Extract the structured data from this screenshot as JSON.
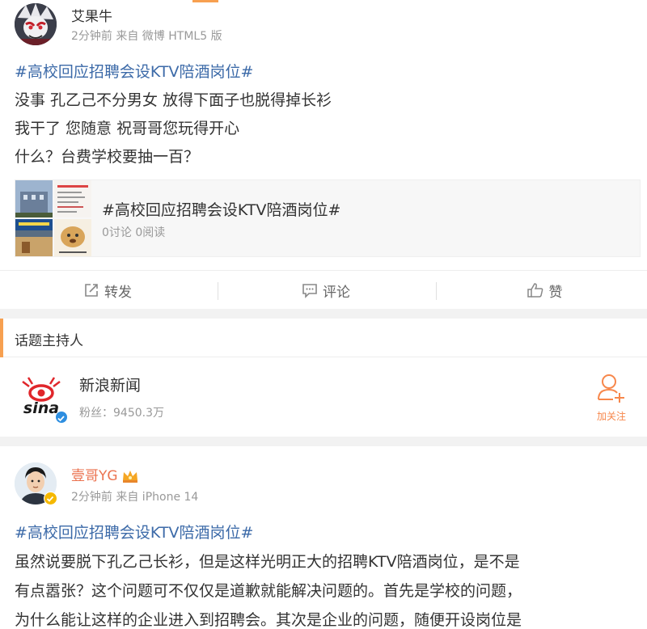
{
  "post1": {
    "author": "艾果牛",
    "meta": "2分钟前 来自 微博 HTML5 版",
    "hashtag": "#高校回应招聘会设KTV陪酒岗位#",
    "lines": [
      "没事 孔乙己不分男女 放得下面子也脱得掉长衫",
      "我干了 您随意 祝哥哥您玩得开心",
      "什么？台费学校要抽一百？"
    ],
    "topic_card": {
      "title": "#高校回应招聘会设KTV陪酒岗位#",
      "stats": "0讨论 0阅读"
    },
    "actions": {
      "repost": "转发",
      "comment": "评论",
      "like": "赞"
    }
  },
  "host_section": {
    "header": "话题主持人",
    "name": "新浪新闻",
    "fans": "粉丝：9450.3万",
    "follow_label": "加关注",
    "logo_text": "sina"
  },
  "post2": {
    "author": "壹哥YG",
    "meta": "2分钟前 来自 iPhone 14",
    "hashtag": "#高校回应招聘会设KTV陪酒岗位#",
    "lines": [
      "虽然说要脱下孔乙己长衫，但是这样光明正大的招聘KTV陪酒岗位，是不是",
      "有点嚣张？这个问题可不仅仅是道歉就能解决问题的。首先是学校的问题，",
      "为什么能让这样的企业进入到招聘会。其次是企业的问题，随便开设岗位是"
    ]
  },
  "colors": {
    "link": "#3c6aa8",
    "accent_orange": "#f7a050",
    "follow_orange": "#f7874b",
    "author2_orange": "#eb7350",
    "verify_blue": "#2d8ee0",
    "verify_yellow": "#f5b800"
  },
  "icons": {
    "repost": "share-arrow-icon",
    "comment": "comment-bubble-icon",
    "like": "thumbs-up-icon",
    "follow": "add-user-icon",
    "verified": "verified-badge-icon",
    "crown": "crown-icon"
  }
}
